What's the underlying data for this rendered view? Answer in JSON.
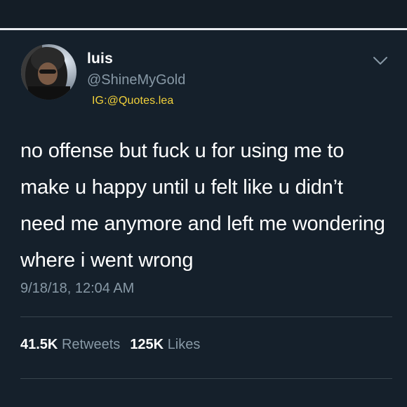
{
  "user": {
    "display_name": "luis",
    "handle": "@ShineMyGold",
    "ig_tag": "IG:@Quotes.lea",
    "avatar_icon": "avatar-photo"
  },
  "tweet": {
    "text": "no offense but fuck u for using me to make u happy until u felt like u didn’t need me anymore and left me wondering where i went wrong",
    "timestamp": "9/18/18, 12:04 AM"
  },
  "stats": {
    "retweets_count": "41.5K",
    "retweets_label": "Retweets",
    "likes_count": "125K",
    "likes_label": "Likes"
  },
  "menu": {
    "icon": "chevron-down-icon"
  },
  "colors": {
    "background": "#15202b",
    "text": "#ffffff",
    "secondary_text": "#8899a6",
    "ig_tag": "#f2d13a",
    "divider": "#38444d"
  }
}
